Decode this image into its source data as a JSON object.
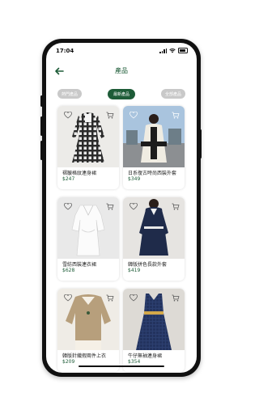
{
  "status": {
    "time": "17:04"
  },
  "nav": {
    "title": "產品",
    "back_icon": "arrow-left-icon"
  },
  "tabs": [
    {
      "label": "熱門產品",
      "active": false
    },
    {
      "label": "最新產品",
      "active": true
    },
    {
      "label": "全部產品",
      "active": false
    }
  ],
  "products": [
    {
      "name": "褶皺格紋連身裙",
      "price": "$247"
    },
    {
      "name": "日系復古時尚西裝外套",
      "price": "$349"
    },
    {
      "name": "雪紡西裝連衣裙",
      "price": "$628"
    },
    {
      "name": "韓版拼色長款外套",
      "price": "$419"
    },
    {
      "name": "韓版針織假兩件上衣",
      "price": "$209"
    },
    {
      "name": "牛仔無袖連身裙",
      "price": "$354"
    }
  ],
  "colors": {
    "brand": "#1e5c38",
    "tab_inactive": "#c9c9c9"
  }
}
